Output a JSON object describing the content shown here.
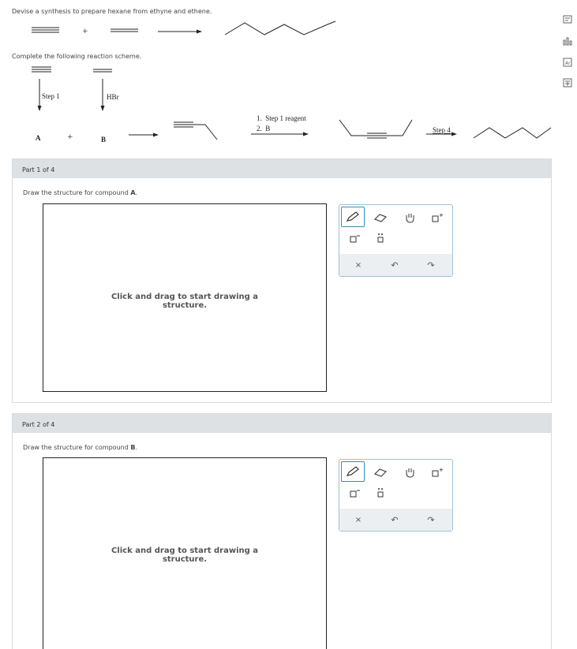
{
  "prompt": "Devise a synthesis to prepare hexane from ethyne and ethene.",
  "plus": "+",
  "instruction": "Complete the following reaction scheme.",
  "scheme": {
    "step1_label": "Step 1",
    "hbr_label": "HBr",
    "compound_a": "A",
    "compound_b": "B",
    "conditions_line1": "1.  Step 1 reagent",
    "conditions_line2": "2.  B",
    "step4_label": "Step 4"
  },
  "parts": [
    {
      "header": "Part 1 of 4",
      "question_prefix": "Draw the structure for compound ",
      "question_compound": "A",
      "question_suffix": ".",
      "hint": "Click and drag to start drawing a structure."
    },
    {
      "header": "Part 2 of 4",
      "question_prefix": "Draw the structure for compound ",
      "question_compound": "B",
      "question_suffix": ".",
      "hint": "Click and drag to start drawing a structure."
    }
  ],
  "tools": [
    "pencil-icon",
    "eraser-icon",
    "hand-pan-icon",
    "charge-plus-icon",
    "charge-minus-icon",
    "lone-pair-icon",
    "clear-x-icon",
    "undo-icon",
    "redo-icon"
  ],
  "side_icons": [
    "notes-icon",
    "data-chart-icon",
    "periodic-table-icon",
    "calculator-icon"
  ]
}
